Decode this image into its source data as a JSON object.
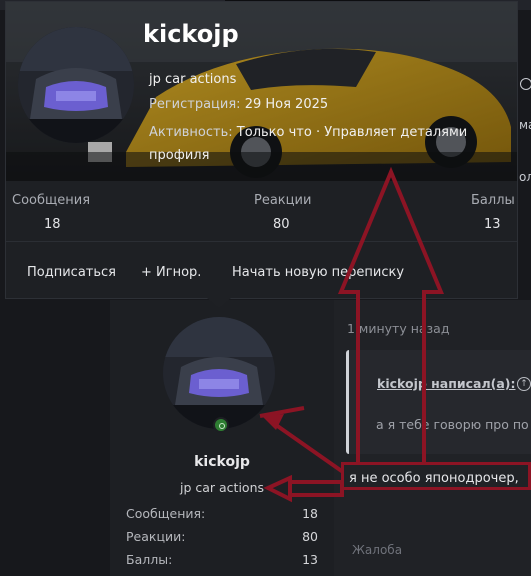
{
  "popup": {
    "username": "kickojp",
    "user_title": "jp car actions",
    "registration_label": "Регистрация:",
    "registration_value": "29 Ноя 2025",
    "activity_label": "Активность:",
    "activity_value_line1": "Только что · Управляет деталями",
    "activity_value_line2": "профиля",
    "stats": [
      {
        "label": "Сообщения",
        "value": "18"
      },
      {
        "label": "Реакции",
        "value": "80"
      },
      {
        "label": "Баллы",
        "value": "13"
      }
    ],
    "actions": {
      "follow": "Подписаться",
      "ignore": "+ Игнор.",
      "start_conversation": "Начать новую переписку"
    }
  },
  "post": {
    "username": "kickojp",
    "user_title": "jp car actions",
    "stats": [
      {
        "label": "Сообщения:",
        "value": "18"
      },
      {
        "label": "Реакции:",
        "value": "80"
      },
      {
        "label": "Баллы:",
        "value": "13"
      }
    ],
    "time": "1 минуту назад",
    "quote_author": "kickojp написал(а):",
    "quote_text": "а я тебе говорю про по",
    "message": "я не особо японодрочер,",
    "report": "Жалоба"
  },
  "edge_fragments": {
    "ma": "ма",
    "ol": "ол"
  },
  "colors": {
    "annotation": "#8c1424",
    "online": "#2e7d32",
    "car_yellow": "#d7a81a"
  }
}
